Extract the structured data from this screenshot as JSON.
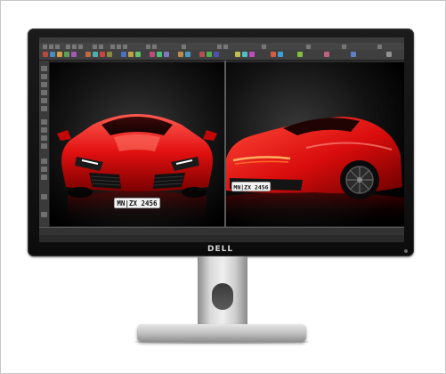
{
  "brand": {
    "logo_text": "DELL",
    "accent": "#d8d8d8"
  },
  "screen": {
    "viewport_left": {
      "car_color": "#e01010",
      "license_plate": "MN|ZX 2456"
    },
    "viewport_right": {
      "car_color": "#e01010",
      "license_plate": "MN|ZX 2456"
    },
    "status_text": "",
    "background": "#2b2b2b"
  },
  "icons": [
    "power-button-icon",
    "toolbar-icon",
    "side-toolbar-icon"
  ]
}
